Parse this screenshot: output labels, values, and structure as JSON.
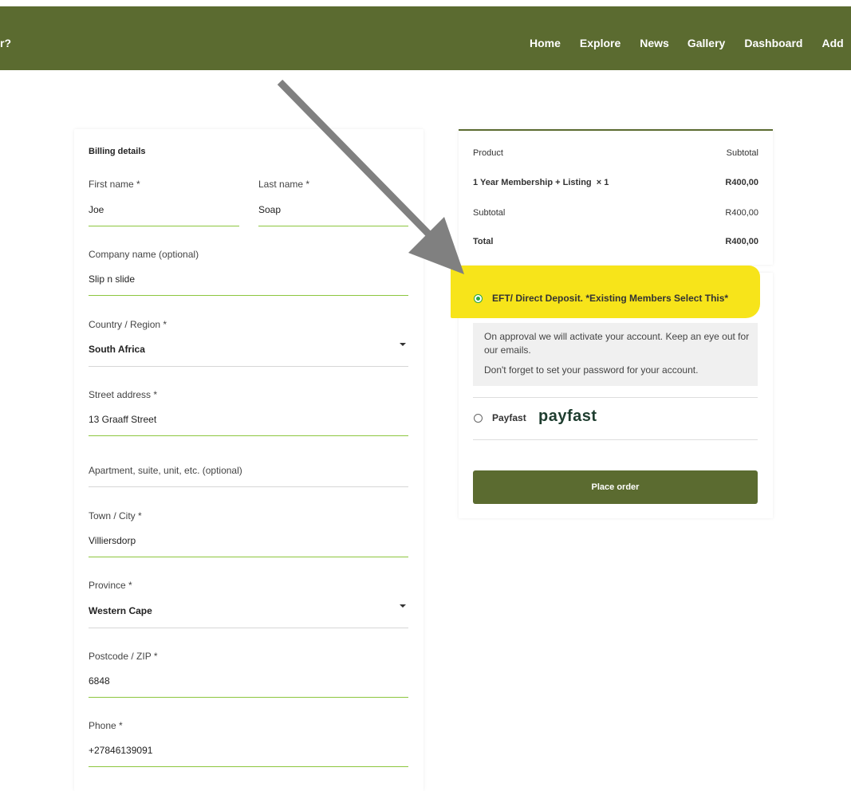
{
  "header": {
    "site_title_fragment": "r?",
    "nav": [
      "Home",
      "Explore",
      "News",
      "Gallery",
      "Dashboard",
      "Add"
    ]
  },
  "billing": {
    "title": "Billing details",
    "first_name": {
      "label": "First name *",
      "value": "Joe"
    },
    "last_name": {
      "label": "Last name *",
      "value": "Soap"
    },
    "company": {
      "label": "Company name (optional)",
      "value": "Slip n slide"
    },
    "country": {
      "label": "Country / Region *",
      "value": "South Africa"
    },
    "street": {
      "label": "Street address *",
      "value": "13 Graaff Street"
    },
    "apartment": {
      "label": "Apartment, suite, unit, etc. (optional)",
      "value": ""
    },
    "city": {
      "label": "Town / City *",
      "value": "Villiersdorp"
    },
    "province": {
      "label": "Province *",
      "value": "Western Cape"
    },
    "postcode": {
      "label": "Postcode / ZIP *",
      "value": "6848"
    },
    "phone": {
      "label": "Phone *",
      "value": "+27846139091"
    }
  },
  "order": {
    "product_header": "Product",
    "subtotal_header": "Subtotal",
    "item_name": "1 Year Membership + Listing",
    "item_qty": "× 1",
    "item_price": "R400,00",
    "subtotal_label": "Subtotal",
    "subtotal_value": "R400,00",
    "total_label": "Total",
    "total_value": "R400,00"
  },
  "payment": {
    "eft_label": "EFT/ Direct Deposit. *Existing Members Select This*",
    "eft_selected": true,
    "eft_desc_1": "On approval we will activate your account. Keep an eye out for our emails.",
    "eft_desc_2": "Don't forget to set your password for your account.",
    "payfast_label": "Payfast",
    "payfast_logo": "payfast",
    "place_order": "Place order"
  },
  "colors": {
    "brand": "#5b6b30",
    "field_underline": "#8dc63f",
    "highlight": "#f7e41a",
    "annotation_arrow": "#808080"
  }
}
